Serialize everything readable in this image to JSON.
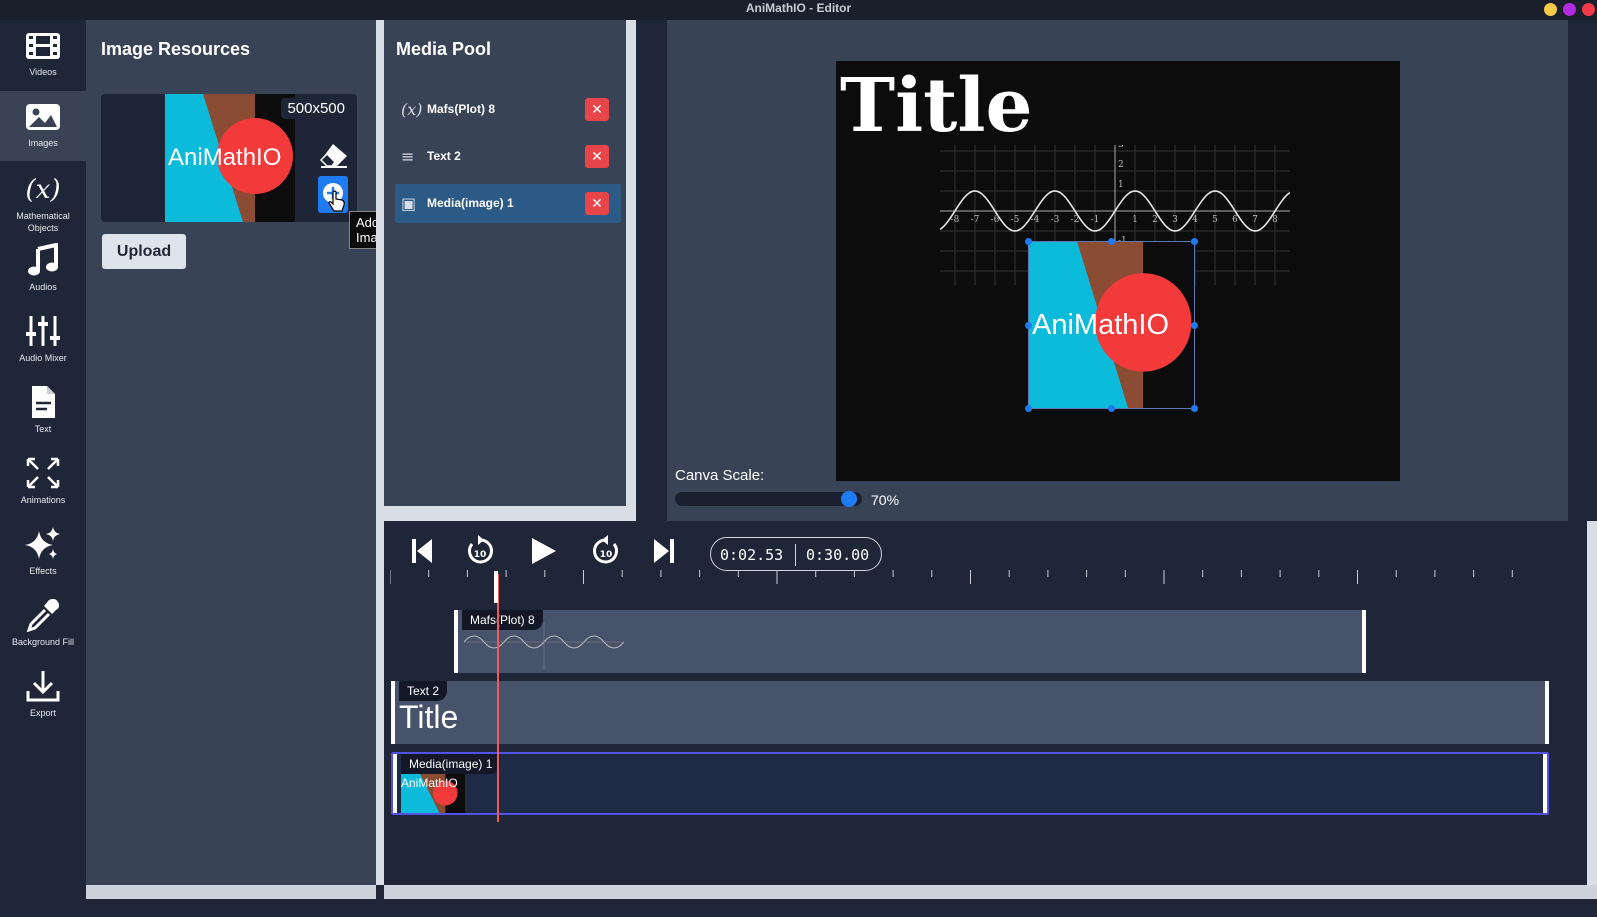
{
  "window": {
    "title": "AniMathIO - Editor"
  },
  "sidebar": {
    "items": [
      {
        "label": "Videos",
        "icon": "film-icon"
      },
      {
        "label": "Images",
        "icon": "image-icon"
      },
      {
        "label": "Mathematical Objects",
        "icon": "function-icon"
      },
      {
        "label": "Audios",
        "icon": "music-icon"
      },
      {
        "label": "Audio Mixer",
        "icon": "sliders-icon"
      },
      {
        "label": "Text",
        "icon": "document-icon"
      },
      {
        "label": "Animations",
        "icon": "expand-icon"
      },
      {
        "label": "Effects",
        "icon": "sparkle-icon"
      },
      {
        "label": "Background Fill",
        "icon": "eyedropper-icon"
      },
      {
        "label": "Export",
        "icon": "download-icon"
      }
    ],
    "active": "Images"
  },
  "image_resources": {
    "title": "Image Resources",
    "thumb_size": "500x500",
    "thumb_text": "AniMathIO",
    "upload_label": "Upload",
    "tooltip": "Add Image"
  },
  "media_pool": {
    "title": "Media Pool",
    "items": [
      {
        "icon": "(x)",
        "label": "Mafs(Plot) 8"
      },
      {
        "icon": "≡",
        "label": "Text 2"
      },
      {
        "icon": "▣",
        "label": "Media(image) 1"
      }
    ],
    "delete_symbol": "✕"
  },
  "preview": {
    "canvas_title": "Title",
    "image_text": "AniMathIO",
    "scale_label": "Canva Scale:",
    "scale_value": "70%",
    "scale_fraction": 0.97
  },
  "plot": {
    "x_ticks": [
      "-8",
      "-7",
      "-6",
      "-5",
      "-4",
      "-3",
      "-2",
      "-1",
      "1",
      "2",
      "3",
      "4",
      "5",
      "6",
      "7",
      "8"
    ],
    "y_ticks": [
      "3",
      "2",
      "1",
      "-1"
    ]
  },
  "timeline": {
    "current_time": "0:02.53",
    "total_time": "0:30.00",
    "tracks": [
      {
        "label": "Mafs(Plot) 8"
      },
      {
        "label": "Text 2",
        "preview": "Title"
      },
      {
        "label": "Media(image) 1",
        "preview": "AniMathIO"
      }
    ]
  },
  "colors": {
    "accent": "#1e7bf2",
    "delete": "#e8454a",
    "selected_item": "#2b5a87",
    "logo_cyan": "#0cbad9",
    "logo_brown": "#8b4c33",
    "logo_red": "#f23a3a",
    "playhead": "#f05a5a"
  }
}
